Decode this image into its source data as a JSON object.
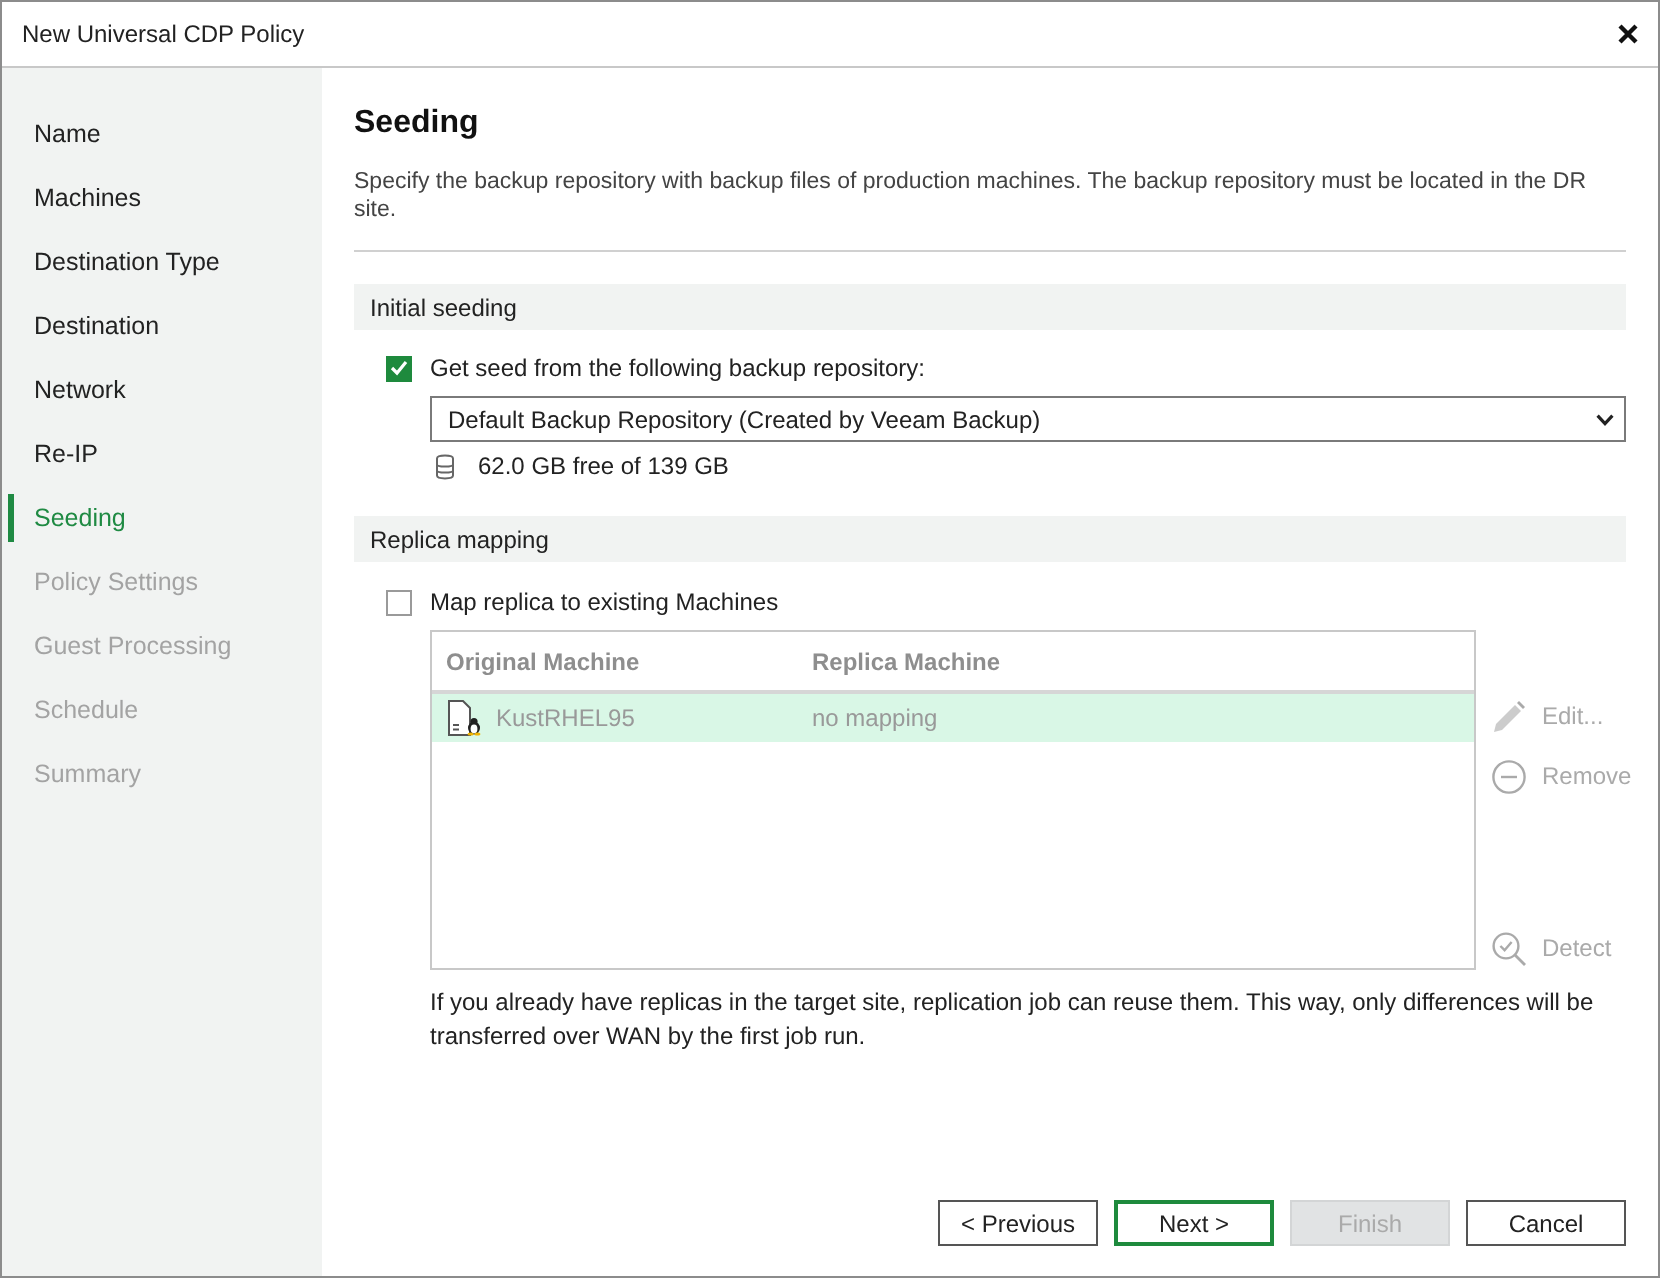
{
  "window": {
    "title": "New Universal CDP Policy"
  },
  "sidebar": {
    "items": [
      {
        "label": "Name",
        "selected": false,
        "disabled": false
      },
      {
        "label": "Machines",
        "selected": false,
        "disabled": false
      },
      {
        "label": "Destination Type",
        "selected": false,
        "disabled": false
      },
      {
        "label": "Destination",
        "selected": false,
        "disabled": false
      },
      {
        "label": "Network",
        "selected": false,
        "disabled": false
      },
      {
        "label": "Re-IP",
        "selected": false,
        "disabled": false
      },
      {
        "label": "Seeding",
        "selected": true,
        "disabled": false
      },
      {
        "label": "Policy Settings",
        "selected": false,
        "disabled": true
      },
      {
        "label": "Guest Processing",
        "selected": false,
        "disabled": true
      },
      {
        "label": "Schedule",
        "selected": false,
        "disabled": true
      },
      {
        "label": "Summary",
        "selected": false,
        "disabled": true
      }
    ]
  },
  "page": {
    "title": "Seeding",
    "description": "Specify the backup repository with backup files of production machines. The backup repository must be located in the DR site."
  },
  "initial_seeding": {
    "title": "Initial seeding",
    "checkbox": {
      "label": "Get seed from the following backup repository:",
      "checked": true
    },
    "repository": {
      "value": "Default Backup Repository (Created by Veeam Backup)"
    },
    "capacity": "62.0 GB free of 139 GB"
  },
  "replica_mapping": {
    "title": "Replica mapping",
    "checkbox": {
      "label": "Map replica to existing Machines",
      "checked": false
    },
    "table": {
      "columns": [
        "Original Machine",
        "Replica Machine"
      ],
      "rows": [
        {
          "original": "KustRHEL95",
          "replica": "no mapping",
          "selected": true
        }
      ]
    },
    "actions": [
      {
        "kind": "edit",
        "label": "Edit...",
        "disabled": true
      },
      {
        "kind": "remove",
        "label": "Remove",
        "disabled": true
      },
      {
        "kind": "detect",
        "label": "Detect",
        "disabled": true
      }
    ],
    "note": "If you already have replicas in the target site, replication job can reuse them. This way, only differences will be transferred over WAN by the first job run."
  },
  "buttons": [
    {
      "label": "< Previous",
      "default": false,
      "disabled": false
    },
    {
      "label": "Next >",
      "default": true,
      "disabled": false
    },
    {
      "label": "Finish",
      "default": false,
      "disabled": true
    },
    {
      "label": "Cancel",
      "default": false,
      "disabled": false
    }
  ]
}
